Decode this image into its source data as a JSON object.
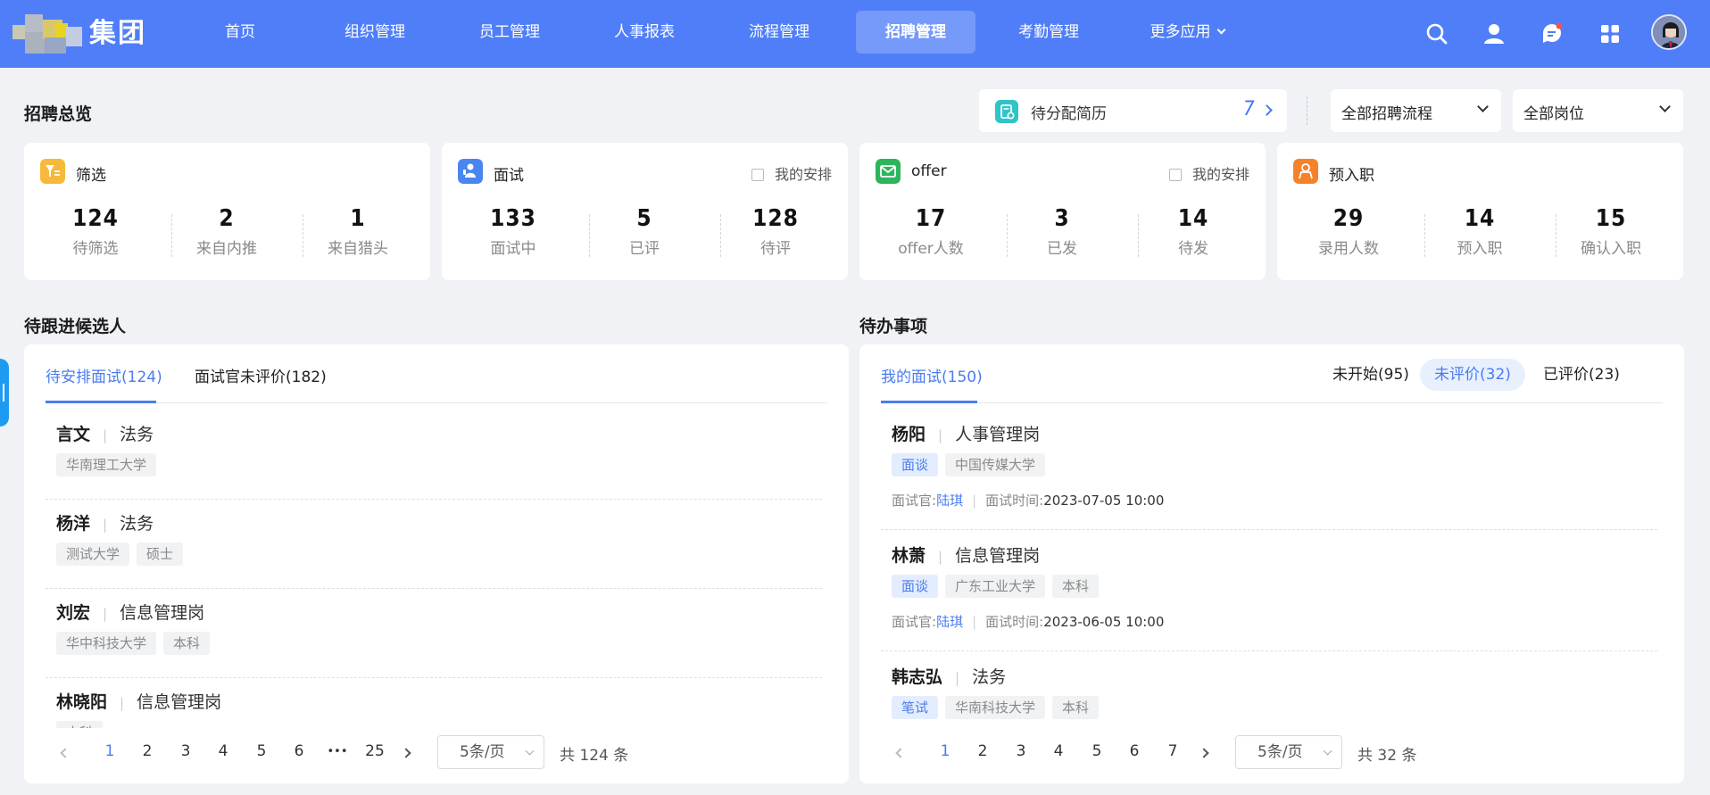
{
  "brand": {
    "name": "集团"
  },
  "nav": {
    "items": [
      "首页",
      "组织管理",
      "员工管理",
      "人事报表",
      "流程管理",
      "招聘管理",
      "考勤管理",
      "更多应用"
    ],
    "active": "招聘管理"
  },
  "top_icons": [
    "search-icon",
    "user-icon",
    "message-icon",
    "apps-icon",
    "avatar"
  ],
  "overview": {
    "title": "招聘总览",
    "pending": {
      "label": "待分配简历",
      "count": "7"
    },
    "process_select": "全部招聘流程",
    "position_select": "全部岗位"
  },
  "cards": [
    {
      "title": "筛选",
      "icon": "filter-icon",
      "color": "#f6b93b",
      "checkbox": null,
      "stats": [
        {
          "value": "124",
          "label": "待筛选"
        },
        {
          "value": "2",
          "label": "来自内推"
        },
        {
          "value": "1",
          "label": "来自猎头"
        }
      ]
    },
    {
      "title": "面试",
      "icon": "interview-icon",
      "color": "#4a86f0",
      "checkbox": "我的安排",
      "stats": [
        {
          "value": "133",
          "label": "面试中"
        },
        {
          "value": "5",
          "label": "已评"
        },
        {
          "value": "128",
          "label": "待评"
        }
      ]
    },
    {
      "title": "offer",
      "icon": "mail-icon",
      "color": "#2db55d",
      "checkbox": "我的安排",
      "stats": [
        {
          "value": "17",
          "label": "offer人数"
        },
        {
          "value": "3",
          "label": "已发"
        },
        {
          "value": "14",
          "label": "待发"
        }
      ]
    },
    {
      "title": "预入职",
      "icon": "person-badge-icon",
      "color": "#f5822a",
      "checkbox": null,
      "stats": [
        {
          "value": "29",
          "label": "录用人数"
        },
        {
          "value": "14",
          "label": "预入职"
        },
        {
          "value": "15",
          "label": "确认入职"
        }
      ]
    }
  ],
  "candidates": {
    "title": "待跟进候选人",
    "tabs": [
      "待安排面试(124)",
      "面试官未评价(182)"
    ],
    "active_tab": 0,
    "items": [
      {
        "name": "言文",
        "role": "法务",
        "tags": [
          "华南理工大学"
        ]
      },
      {
        "name": "杨洋",
        "role": "法务",
        "tags": [
          "测试大学",
          "硕士"
        ]
      },
      {
        "name": "刘宏",
        "role": "信息管理岗",
        "tags": [
          "华中科技大学",
          "本科"
        ]
      },
      {
        "name": "林晓阳",
        "role": "信息管理岗",
        "tags": [
          "本科"
        ]
      }
    ],
    "pager": {
      "pages": [
        "1",
        "2",
        "3",
        "4",
        "5",
        "6",
        "•••",
        "25"
      ],
      "current": "1",
      "page_size": "5条/页",
      "total": "共 124 条"
    }
  },
  "todos": {
    "title": "待办事项",
    "tab": "我的面试(150)",
    "filters": [
      "未开始(95)",
      "未评价(32)",
      "已评价(23)"
    ],
    "active_filter": 1,
    "interviewer_label": "面试官:",
    "time_label": "面试时间:",
    "items": [
      {
        "name": "杨阳",
        "role": "人事管理岗",
        "type": "面谈",
        "tags": [
          "中国传媒大学"
        ],
        "interviewer": "陆琪",
        "time": "2023-07-05 10:00"
      },
      {
        "name": "林萧",
        "role": "信息管理岗",
        "type": "面谈",
        "tags": [
          "广东工业大学",
          "本科"
        ],
        "interviewer": "陆琪",
        "time": "2023-06-05 10:00"
      },
      {
        "name": "韩志弘",
        "role": "法务",
        "type": "笔试",
        "tags": [
          "华南科技大学",
          "本科"
        ],
        "interviewer": "",
        "time": ""
      }
    ],
    "pager": {
      "pages": [
        "1",
        "2",
        "3",
        "4",
        "5",
        "6",
        "7"
      ],
      "current": "1",
      "page_size": "5条/页",
      "total": "共 32 条"
    }
  }
}
